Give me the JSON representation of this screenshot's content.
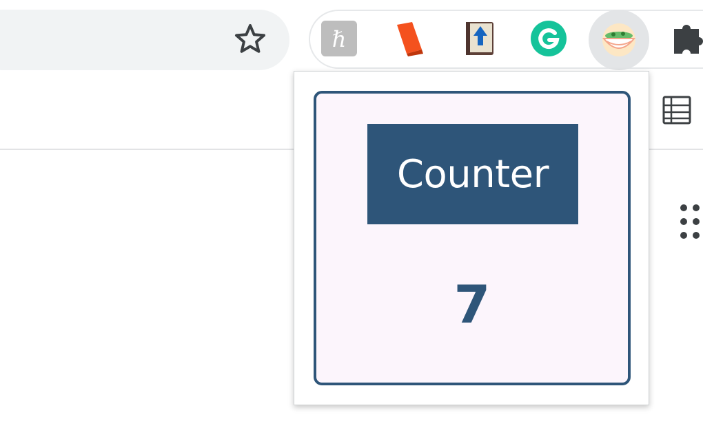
{
  "toolbar": {
    "omnibox": {
      "value": ""
    },
    "bookmark_icon": "star-outline-icon",
    "extensions": [
      {
        "name": "hypothesis-icon",
        "glyph": "ℏ"
      },
      {
        "name": "orange-book-icon"
      },
      {
        "name": "book-upload-icon"
      },
      {
        "name": "grammarly-icon",
        "glyph": "G"
      },
      {
        "name": "noodle-bowl-icon",
        "active": true
      },
      {
        "name": "puzzle-extensions-icon"
      }
    ]
  },
  "popup": {
    "title": "Counter",
    "value": "7"
  },
  "colors": {
    "accent": "#2e5579",
    "card_background": "#fcf5fc",
    "grammarly": "#15c39a",
    "book_orange": "#f4511e"
  }
}
